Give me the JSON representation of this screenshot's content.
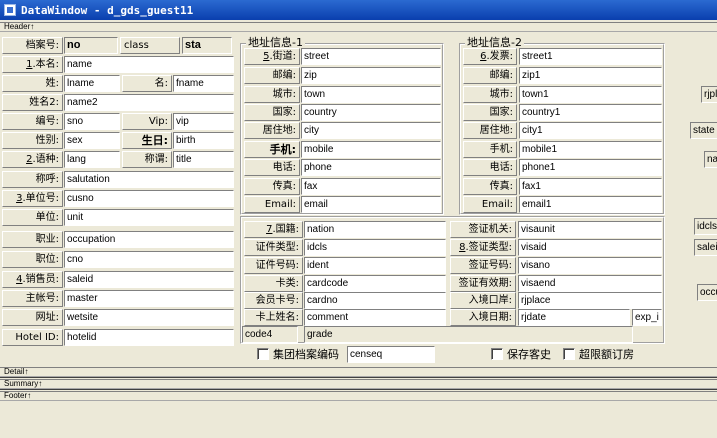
{
  "window": {
    "title": "DataWindow - d_gds_guest11"
  },
  "bands": {
    "header": "Header↑",
    "detail": "Detail↑",
    "summary": "Summary↑",
    "footer": "Footer↑"
  },
  "groups": {
    "address1": "地址信息-1",
    "address2": "地址信息-2"
  },
  "left": {
    "file_no_label": "档案号:",
    "file_no_value": "no",
    "class_label": "class",
    "class_value": "sta",
    "name_label": "本名:",
    "name_value": "name",
    "surname_label": "姓:",
    "surname_value": "lname",
    "given_label": "名:",
    "given_value": "fname",
    "name2_label": "姓名2:",
    "name2_value": "name2",
    "sno_label": "编号:",
    "sno_value": "sno",
    "vip_label": "Vip:",
    "vip_value": "vip",
    "sex_label": "性别:",
    "sex_value": "sex",
    "birth_label": "生日:",
    "birth_value": "birth",
    "lang_label": "语种:",
    "lang_value": "lang",
    "title_label": "称谓:",
    "title_value": "title",
    "salutation_label": "称呼:",
    "salutation_value": "salutation",
    "cusno_label": "单位号:",
    "cusno_value": "cusno",
    "unit_label": "单位:",
    "unit_value": "unit",
    "occupation_label": "职业:",
    "occupation_value": "occupation",
    "cno_label": "职位:",
    "cno_value": "cno",
    "saleid_label": "销售员:",
    "saleid_value": "saleid",
    "master_label": "主帐号:",
    "master_value": "master",
    "website_label": "网址:",
    "website_value": "wetsite",
    "hotelid_label": "Hotel ID:",
    "hotelid_value": "hotelid"
  },
  "address1": {
    "street_label": "街道:",
    "street_value": "street",
    "zip_label": "邮编:",
    "zip_value": "zip",
    "town_label": "城市:",
    "town_value": "town",
    "country_label": "国家:",
    "country_value": "country",
    "city_label": "居住地:",
    "city_value": "city",
    "mobile_label": "手机:",
    "mobile_value": "mobile",
    "phone_label": "电话:",
    "phone_value": "phone",
    "fax_label": "传真:",
    "fax_value": "fax",
    "email_label": "Email:",
    "email_value": "email"
  },
  "address2": {
    "street_label": "发票:",
    "street_value": "street1",
    "zip_label": "邮编:",
    "zip_value": "zip1",
    "town_label": "城市:",
    "town_value": "town1",
    "country_label": "国家:",
    "country_value": "country1",
    "city_label": "居住地:",
    "city_value": "city1",
    "mobile_label": "手机:",
    "mobile_value": "mobile1",
    "phone_label": "电话:",
    "phone_value": "phone1",
    "fax_label": "传真:",
    "fax_value": "fax1",
    "email_label": "Email:",
    "email_value": "email1"
  },
  "id": {
    "nation_label": "国籍:",
    "nation_value": "nation",
    "idcls_label": "证件类型:",
    "idcls_value": "idcls",
    "ident_label": "证件号码:",
    "ident_value": "ident",
    "cardcode_label": "卡类:",
    "cardcode_value": "cardcode",
    "cardno_label": "会员卡号:",
    "cardno_value": "cardno",
    "comment_label": "卡上姓名:",
    "comment_value": "comment",
    "code4_value": "code4",
    "grade_value": "grade"
  },
  "visa": {
    "visaunit_label": "签证机关:",
    "visaunit_value": "visaunit",
    "visaid_label": "签证类型:",
    "visaid_value": "visaid",
    "visano_label": "签证号码:",
    "visano_value": "visano",
    "visaend_label": "签证有效期:",
    "visaend_value": "visaend",
    "rjplace_label": "入境口岸:",
    "rjplace_value": "rjplace",
    "rjdate_label": "入境日期:",
    "rjdate_value": "rjdate",
    "exp_value": "exp_i"
  },
  "checks": {
    "censeq_label": "集团档案编码",
    "censeq_value": "censeq",
    "keeper_label": "保存客史",
    "overlimit_label": "超限额订房"
  },
  "right_edge": {
    "rjpl": "rjpl",
    "state": "state",
    "na": "na",
    "idcls": "idcls",
    "saleid": "saleid",
    "occu": "occu"
  }
}
